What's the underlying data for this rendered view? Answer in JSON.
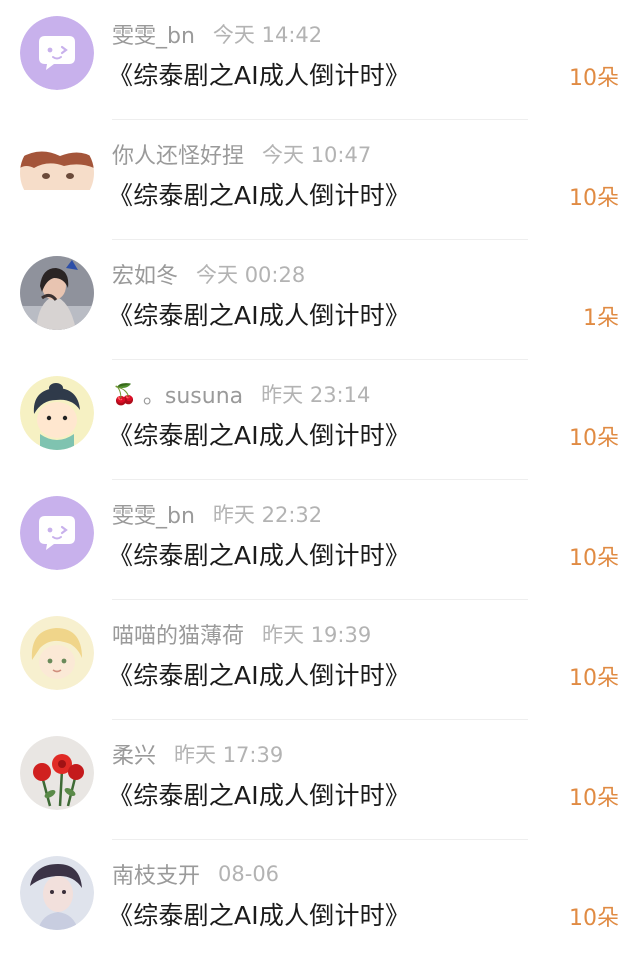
{
  "items": [
    {
      "avatar_icon": "purple-chat-bubble-avatar",
      "name": "雯雯_bn",
      "time": "今天 14:42",
      "title": "《综泰剧之AI成人倒计时》",
      "gift": "10朵"
    },
    {
      "avatar_icon": "anime-boy-avatar",
      "name": "你人还怪好捏",
      "time": "今天 10:47",
      "title": "《综泰剧之AI成人倒计时》",
      "gift": "10朵"
    },
    {
      "avatar_icon": "girl-photo-avatar",
      "name": "宏如冬",
      "time": "今天 00:28",
      "title": "《综泰剧之AI成人倒计时》",
      "gift": "1朵"
    },
    {
      "avatar_icon": "cartoon-kid-avatar",
      "name_prefix": "🍒",
      "name": "。susuna",
      "time": "昨天 23:14",
      "title": "《综泰剧之AI成人倒计时》",
      "gift": "10朵"
    },
    {
      "avatar_icon": "purple-chat-bubble-avatar",
      "name": "雯雯_bn",
      "time": "昨天 22:32",
      "title": "《综泰剧之AI成人倒计时》",
      "gift": "10朵"
    },
    {
      "avatar_icon": "anime-blond-avatar",
      "name": "喵喵的猫薄荷",
      "time": "昨天 19:39",
      "title": "《综泰剧之AI成人倒计时》",
      "gift": "10朵"
    },
    {
      "avatar_icon": "red-roses-avatar",
      "name": "柔兴",
      "time": "昨天 17:39",
      "title": "《综泰剧之AI成人倒计时》",
      "gift": "10朵"
    },
    {
      "avatar_icon": "portrait-man-avatar",
      "name": "南枝支开",
      "time": "08-06",
      "title": "《综泰剧之AI成人倒计时》",
      "gift": "10朵"
    }
  ],
  "colors": {
    "gift": "#e08b43",
    "name": "#9a9a9a",
    "time": "#b3b3b3",
    "title": "#1b1b1b",
    "avatar_purple": "#c8b1ec"
  }
}
